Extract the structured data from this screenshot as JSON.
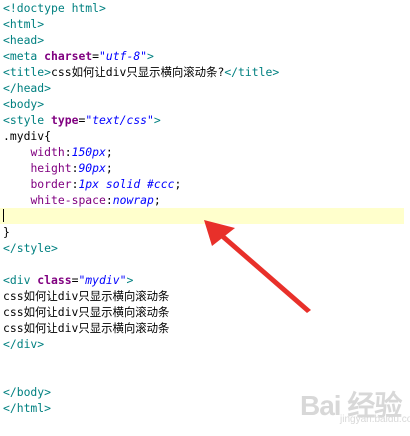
{
  "editor": {
    "current_line_index": 13,
    "lines": [
      [
        {
          "t": "tag",
          "v": "<!doctype html>"
        }
      ],
      [
        {
          "t": "tag",
          "v": "<html>"
        }
      ],
      [
        {
          "t": "tag",
          "v": "<head>"
        }
      ],
      [
        {
          "t": "tag",
          "v": "<meta "
        },
        {
          "t": "attr",
          "v": "charset"
        },
        {
          "t": "punct",
          "v": "="
        },
        {
          "t": "str",
          "v": "\"utf-8\""
        },
        {
          "t": "tag",
          "v": ">"
        }
      ],
      [
        {
          "t": "tag",
          "v": "<title>"
        },
        {
          "t": "plain",
          "v": "css如何让div只显示横向滚动条?"
        },
        {
          "t": "tag",
          "v": "</title>"
        }
      ],
      [
        {
          "t": "tag",
          "v": "</head>"
        }
      ],
      [
        {
          "t": "tag",
          "v": "<body>"
        }
      ],
      [
        {
          "t": "tag",
          "v": "<style "
        },
        {
          "t": "attr",
          "v": "type"
        },
        {
          "t": "punct",
          "v": "="
        },
        {
          "t": "str",
          "v": "\"text/css\""
        },
        {
          "t": "tag",
          "v": ">"
        }
      ],
      [
        {
          "t": "plain",
          "v": ".mydiv{"
        }
      ],
      [
        {
          "t": "plain",
          "v": "    "
        },
        {
          "t": "css-prop",
          "v": "width"
        },
        {
          "t": "punct",
          "v": ":"
        },
        {
          "t": "css-val",
          "v": "150px"
        },
        {
          "t": "punct",
          "v": ";"
        }
      ],
      [
        {
          "t": "plain",
          "v": "    "
        },
        {
          "t": "css-prop",
          "v": "height"
        },
        {
          "t": "punct",
          "v": ":"
        },
        {
          "t": "css-val",
          "v": "90px"
        },
        {
          "t": "punct",
          "v": ";"
        }
      ],
      [
        {
          "t": "plain",
          "v": "    "
        },
        {
          "t": "css-prop",
          "v": "border"
        },
        {
          "t": "punct",
          "v": ":"
        },
        {
          "t": "css-val",
          "v": "1px solid #ccc"
        },
        {
          "t": "punct",
          "v": ";"
        }
      ],
      [
        {
          "t": "plain",
          "v": "    "
        },
        {
          "t": "css-prop",
          "v": "white-space"
        },
        {
          "t": "punct",
          "v": ":"
        },
        {
          "t": "css-val",
          "v": "nowrap"
        },
        {
          "t": "punct",
          "v": ";"
        }
      ],
      [
        {
          "t": "caret",
          "v": ""
        }
      ],
      [
        {
          "t": "plain",
          "v": "}"
        }
      ],
      [
        {
          "t": "tag",
          "v": "</style>"
        }
      ],
      [],
      [
        {
          "t": "tag",
          "v": "<div "
        },
        {
          "t": "attr",
          "v": "class"
        },
        {
          "t": "punct",
          "v": "="
        },
        {
          "t": "str",
          "v": "\"mydiv\""
        },
        {
          "t": "tag",
          "v": ">"
        }
      ],
      [
        {
          "t": "plain",
          "v": "css如何让div只显示横向滚动条"
        }
      ],
      [
        {
          "t": "plain",
          "v": "css如何让div只显示横向滚动条"
        }
      ],
      [
        {
          "t": "plain",
          "v": "css如何让div只显示横向滚动条"
        }
      ],
      [
        {
          "t": "tag",
          "v": "</div>"
        }
      ],
      [],
      [],
      [
        {
          "t": "tag",
          "v": "</body>"
        }
      ],
      [
        {
          "t": "tag",
          "v": "</html>"
        }
      ]
    ]
  },
  "annotation": {
    "arrow_color": "#e8302a"
  },
  "watermark": {
    "logo": "Bai  经验",
    "sub": "jingyan.baidu.com"
  }
}
